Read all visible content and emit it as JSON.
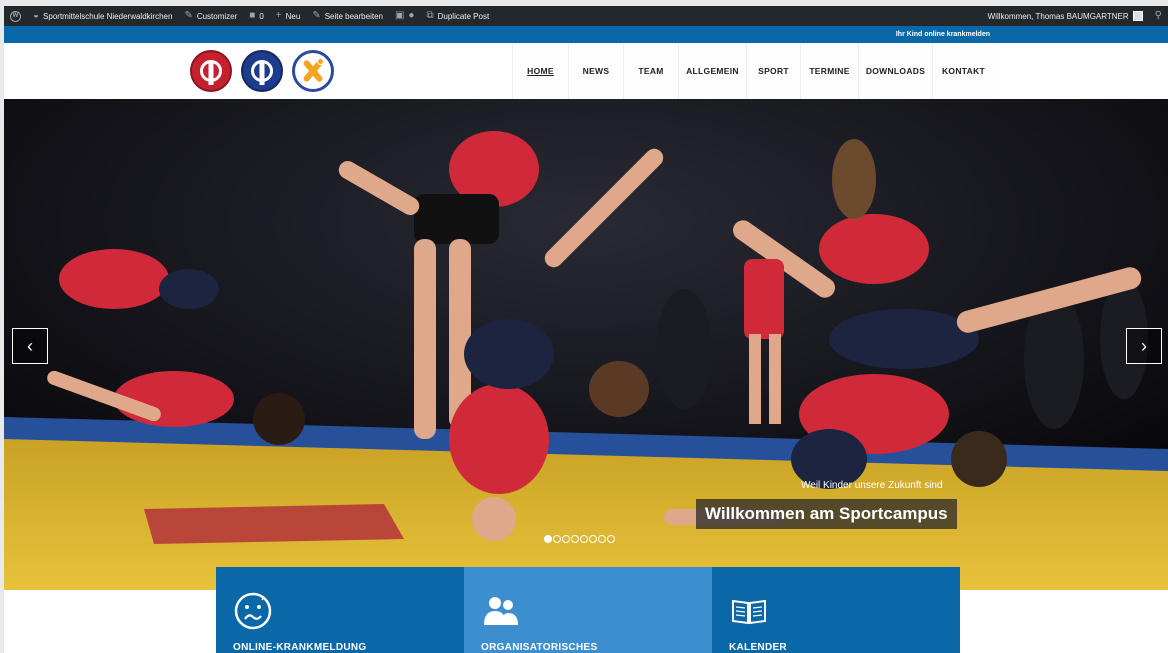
{
  "adminbar": {
    "site_name": "Sportmittelschule Niederwaldkirchen",
    "customizer": "Customizer",
    "comments_count": "0",
    "new_label": "Neu",
    "edit_page": "Seite bearbeiten",
    "duplicate_post": "Duplicate Post",
    "welcome": "Willkommen, Thomas BAUMGARTNER"
  },
  "topstrip": {
    "sick_note_link": "Ihr Kind online krankmelden"
  },
  "nav": {
    "items": [
      {
        "label": "HOME"
      },
      {
        "label": "NEWS"
      },
      {
        "label": "TEAM"
      },
      {
        "label": "ALLGEMEIN"
      },
      {
        "label": "SPORT"
      },
      {
        "label": "TERMINE"
      },
      {
        "label": "DOWNLOADS"
      },
      {
        "label": "KONTAKT"
      }
    ],
    "active": "HOME"
  },
  "slider": {
    "subtitle": "Weil Kinder unsere Zukunft sind",
    "title": "Willkommen am Sportcampus",
    "prev_arrow": "‹",
    "next_arrow": "›",
    "slide_count": 8,
    "current_slide": 1
  },
  "features": [
    {
      "label": "ONLINE-KRANKMELDUNG",
      "icon": "sick-face-icon"
    },
    {
      "label": "ORGANISATORISCHES",
      "icon": "people-icon"
    },
    {
      "label": "KALENDER",
      "icon": "open-book-icon"
    }
  ],
  "colors": {
    "adminbar_bg": "#23282d",
    "brand_blue": "#0a67a8",
    "brand_blue_light": "#3d8ecf",
    "logo_red": "#c5202f",
    "logo_navy": "#1e3c8c",
    "logo_orange": "#f5a323"
  }
}
